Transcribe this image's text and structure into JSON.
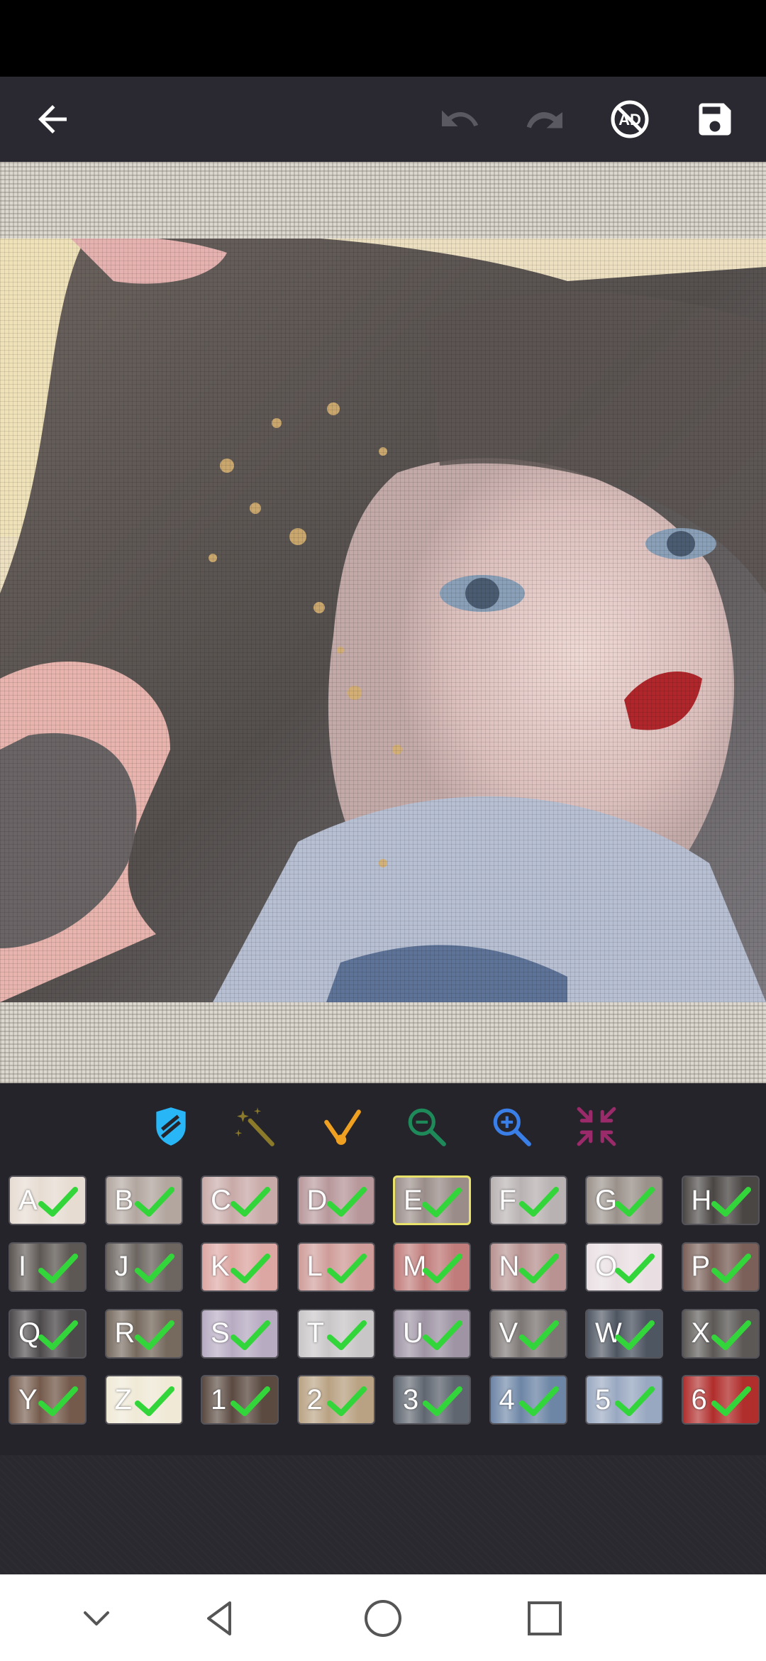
{
  "toolbar": {
    "icons": [
      "back-arrow-icon",
      "undo-icon",
      "redo-icon",
      "no-ads-icon",
      "save-icon"
    ],
    "no_ads_label": "AD"
  },
  "tools": [
    {
      "name": "eraser-icon",
      "color": "#29b6f6"
    },
    {
      "name": "magic-wand-icon",
      "color": "#8a7a2a"
    },
    {
      "name": "fill-brush-icon",
      "color": "#f0a020"
    },
    {
      "name": "zoom-out-icon",
      "color": "#1e8a5a"
    },
    {
      "name": "zoom-in-icon",
      "color": "#3a7ee8"
    },
    {
      "name": "fit-screen-icon",
      "color": "#9a2a6a"
    }
  ],
  "palette": [
    {
      "label": "A",
      "color": "#e6dcd2",
      "done": true
    },
    {
      "label": "B",
      "color": "#b2a69f",
      "done": true
    },
    {
      "label": "C",
      "color": "#c8aaa8",
      "done": true
    },
    {
      "label": "D",
      "color": "#b7979a",
      "done": true
    },
    {
      "label": "E",
      "color": "#9a8d89",
      "done": true,
      "selected": true
    },
    {
      "label": "F",
      "color": "#b9b2b2",
      "done": true
    },
    {
      "label": "G",
      "color": "#9a918a",
      "done": true
    },
    {
      "label": "H",
      "color": "#4a4644",
      "done": true
    },
    {
      "label": "I",
      "color": "#5e5854",
      "done": true
    },
    {
      "label": "J",
      "color": "#6c6560",
      "done": true
    },
    {
      "label": "K",
      "color": "#dca6a2",
      "done": true
    },
    {
      "label": "L",
      "color": "#cf9c99",
      "done": true
    },
    {
      "label": "M",
      "color": "#c07c7a",
      "done": true
    },
    {
      "label": "N",
      "color": "#b89392",
      "done": true
    },
    {
      "label": "O",
      "color": "#e9dfe2",
      "done": true
    },
    {
      "label": "P",
      "color": "#7a6058",
      "done": true
    },
    {
      "label": "Q",
      "color": "#4d4a4b",
      "done": true
    },
    {
      "label": "R",
      "color": "#766a5e",
      "done": true
    },
    {
      "label": "S",
      "color": "#b7abc2",
      "done": true
    },
    {
      "label": "T",
      "color": "#c9c6c8",
      "done": true
    },
    {
      "label": "U",
      "color": "#9e94a4",
      "done": true
    },
    {
      "label": "V",
      "color": "#7c7674",
      "done": true
    },
    {
      "label": "W",
      "color": "#4e5662",
      "done": true
    },
    {
      "label": "X",
      "color": "#5b5855",
      "done": true
    },
    {
      "label": "Y",
      "color": "#745a4b",
      "done": true
    },
    {
      "label": "Z",
      "color": "#efe9d6",
      "done": true
    },
    {
      "label": "1",
      "color": "#5a4a40",
      "done": true
    },
    {
      "label": "2",
      "color": "#b9a283",
      "done": true
    },
    {
      "label": "3",
      "color": "#5f6670",
      "done": true
    },
    {
      "label": "4",
      "color": "#6d86a6",
      "done": true
    },
    {
      "label": "5",
      "color": "#99a8c1",
      "done": true
    },
    {
      "label": "6",
      "color": "#b02e2c",
      "done": true
    }
  ],
  "nav": [
    "chevron-down-icon",
    "back-triangle-icon",
    "home-circle-icon",
    "recents-square-icon"
  ]
}
